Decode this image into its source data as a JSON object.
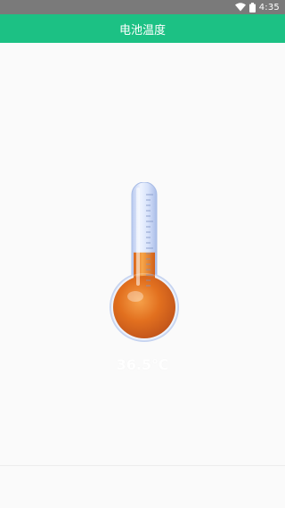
{
  "status_bar": {
    "time": "4:35",
    "icons": [
      "wifi-icon",
      "battery-icon"
    ]
  },
  "app_bar": {
    "title": "电池温度"
  },
  "thermometer": {
    "temperature_value": 36.5,
    "temperature_label": "36.5℃",
    "fill_level_fraction": 0.42
  },
  "colors": {
    "accent": "#1cc184",
    "status_bar": "#7a7a7a",
    "mercury": "#e67e22",
    "background": "#fafafa"
  }
}
